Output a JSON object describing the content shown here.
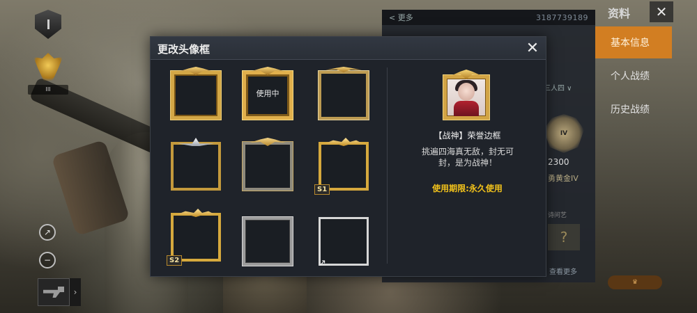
{
  "modal": {
    "title": "更改头像框",
    "close_glyph": "✕",
    "frames": [
      {
        "label": "",
        "tag": ""
      },
      {
        "label": "使用中",
        "tag": ""
      },
      {
        "label": "",
        "tag": ""
      },
      {
        "label": "",
        "tag": ""
      },
      {
        "label": "",
        "tag": ""
      },
      {
        "label": "",
        "tag": "S1"
      },
      {
        "label": "",
        "tag": "S2"
      },
      {
        "label": "",
        "tag": ""
      },
      {
        "label": "",
        "tag": ""
      }
    ],
    "detail": {
      "name": "【战神】荣誉边框",
      "description": "挑遍四海真无敌，封无可封，是为战神！",
      "usage_limit": "使用期限:永久使用"
    }
  },
  "right_tabs": {
    "header": "资料",
    "close_glyph": "✕",
    "items": [
      {
        "label": "基本信息",
        "active": true
      },
      {
        "label": "个人战绩",
        "active": false
      },
      {
        "label": "历史战绩",
        "active": false
      }
    ]
  },
  "profile": {
    "top_left": "< 更多",
    "player_id": "3187739189",
    "mode_text": "三人四 ∨",
    "emblem_text": "IV",
    "score": "2300",
    "tier": "勇黄金IV",
    "sub_label": "诗问艺",
    "question_mark": "?",
    "more": "查看更多"
  },
  "left": {
    "rank_text": "III",
    "share_icon": "↗",
    "zoom_icon": "−",
    "thumb_arrow": "›"
  },
  "colors": {
    "accent_tab": "#d27e22",
    "usage_limit": "#f2c21b",
    "modal_bg": "#1f232a"
  }
}
